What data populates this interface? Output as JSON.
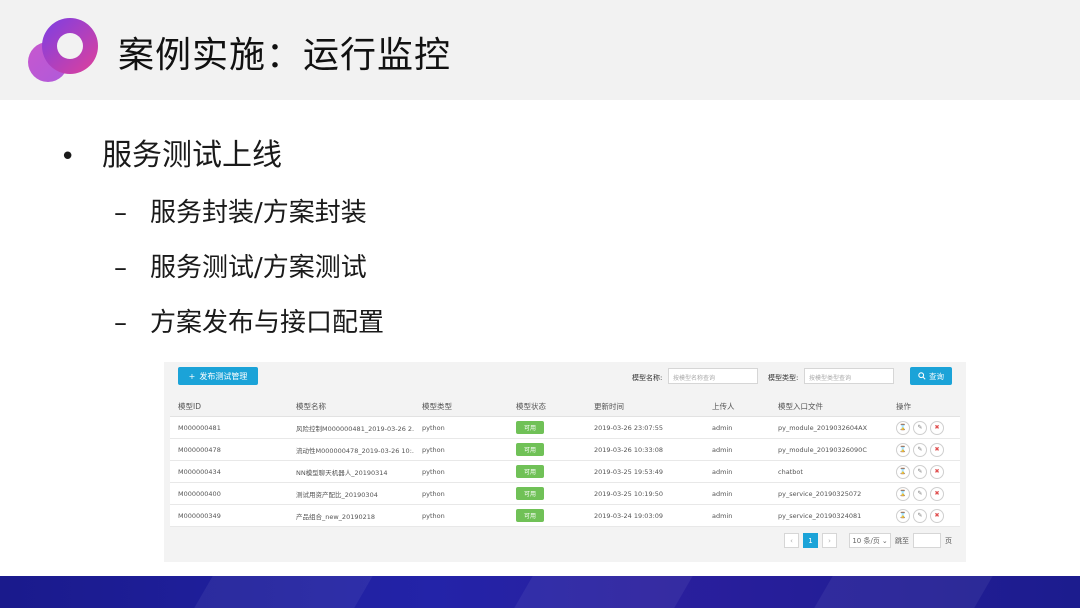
{
  "slide": {
    "title": "案例实施：运行监控",
    "bullet_main": "服务测试上线",
    "bullet_dot": "•",
    "dash": "–",
    "sub_bullets": [
      "服务封装/方案封装",
      "服务测试/方案测试",
      "方案发布与接口配置"
    ]
  },
  "colors": {
    "accent": "#1ba3d8",
    "status_green": "#70c157",
    "footer": "#2323a8"
  },
  "panel": {
    "publish_button": "发布测试管理",
    "publish_icon": "plus-icon",
    "filters": {
      "name_label": "模型名称:",
      "name_placeholder": "按模型名称查询",
      "type_label": "模型类型:",
      "type_placeholder": "按模型类型查询"
    },
    "query_button": "查询",
    "columns": [
      "模型ID",
      "模型名称",
      "模型类型",
      "模型状态",
      "更新时间",
      "上传人",
      "模型入口文件",
      "操作"
    ],
    "rows": [
      {
        "id": "M000000481",
        "name": "风险控制M000000481_2019-03-26 2...",
        "type": "python",
        "status": "可用",
        "time": "2019-03-26 23:07:55",
        "user": "admin",
        "file": "py_module_2019032604AX"
      },
      {
        "id": "M000000478",
        "name": "流动性M000000478_2019-03-26 10:...",
        "type": "python",
        "status": "可用",
        "time": "2019-03-26 10:33:08",
        "user": "admin",
        "file": "py_module_20190326090C"
      },
      {
        "id": "M000000434",
        "name": "NN模型聊天机器人_20190314",
        "type": "python",
        "status": "可用",
        "time": "2019-03-25 19:53:49",
        "user": "admin",
        "file": "chatbot"
      },
      {
        "id": "M000000400",
        "name": "测试用资产配比_20190304",
        "type": "python",
        "status": "可用",
        "time": "2019-03-25 10:19:50",
        "user": "admin",
        "file": "py_service_20190325072"
      },
      {
        "id": "M000000349",
        "name": "产品组合_new_20190218",
        "type": "python",
        "status": "可用",
        "time": "2019-03-24 19:03:09",
        "user": "admin",
        "file": "py_service_20190324081"
      }
    ],
    "op_icons": [
      "hourglass-icon",
      "edit-icon",
      "delete-icon"
    ],
    "pager": {
      "current_page": "1",
      "page_size": "10 条/页",
      "goto_label": "跳至",
      "page_unit": "页"
    }
  }
}
